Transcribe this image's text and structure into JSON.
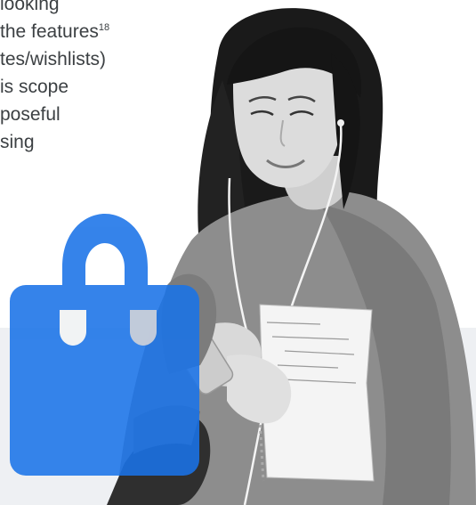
{
  "copy": {
    "line1": "looking",
    "line2": "the features",
    "line2_sup": "18",
    "line3": "tes/wishlists)",
    "line4": "is scope",
    "line5": "poseful",
    "line6": "sing"
  },
  "icons": {
    "bag": "shopping-bag-icon"
  },
  "colors": {
    "bag_blue": "#1a73e8",
    "text": "#3c4043",
    "band": "#eef0f3"
  }
}
